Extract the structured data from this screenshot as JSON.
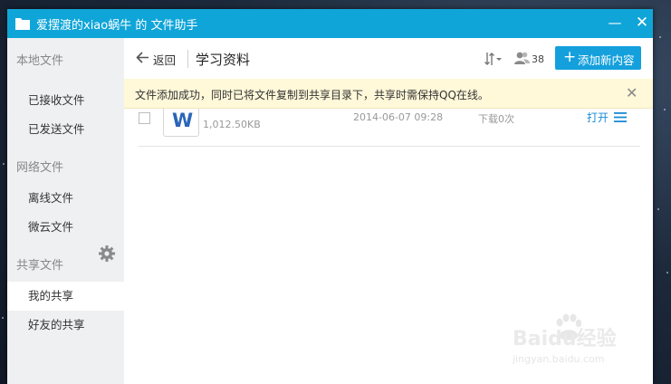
{
  "window": {
    "title": "爱摆渡的xiao蜗牛 的 文件助手",
    "accent_color": "#10a5d8"
  },
  "titlebar": {
    "minimize_icon": "minimize-icon",
    "close_icon": "close-icon"
  },
  "sidebar": {
    "local_section": "本地文件",
    "local_items": [
      "已接收文件",
      "已发送文件"
    ],
    "network_section": "网络文件",
    "network_items": [
      "离线文件",
      "微云文件"
    ],
    "share_section": "共享文件",
    "share_items": [
      "我的共享",
      "好友的共享"
    ],
    "active_item": "我的共享"
  },
  "toolbar": {
    "back_label": "返回",
    "folder_title": "学习资料",
    "member_count": "38",
    "add_button_label": "添加新内容"
  },
  "notice": {
    "text": "文件添加成功，同时已将文件复制到共享目录下，共享时需保持QQ在线。"
  },
  "files": [
    {
      "icon": "word-doc-icon",
      "size": "1,012.50KB",
      "date": "2014-06-07 09:28",
      "downloads": "下载0次",
      "open_label": "打开"
    }
  ],
  "watermark": {
    "brand": "Baidu经验",
    "url": "jingyan.baidu.com"
  }
}
